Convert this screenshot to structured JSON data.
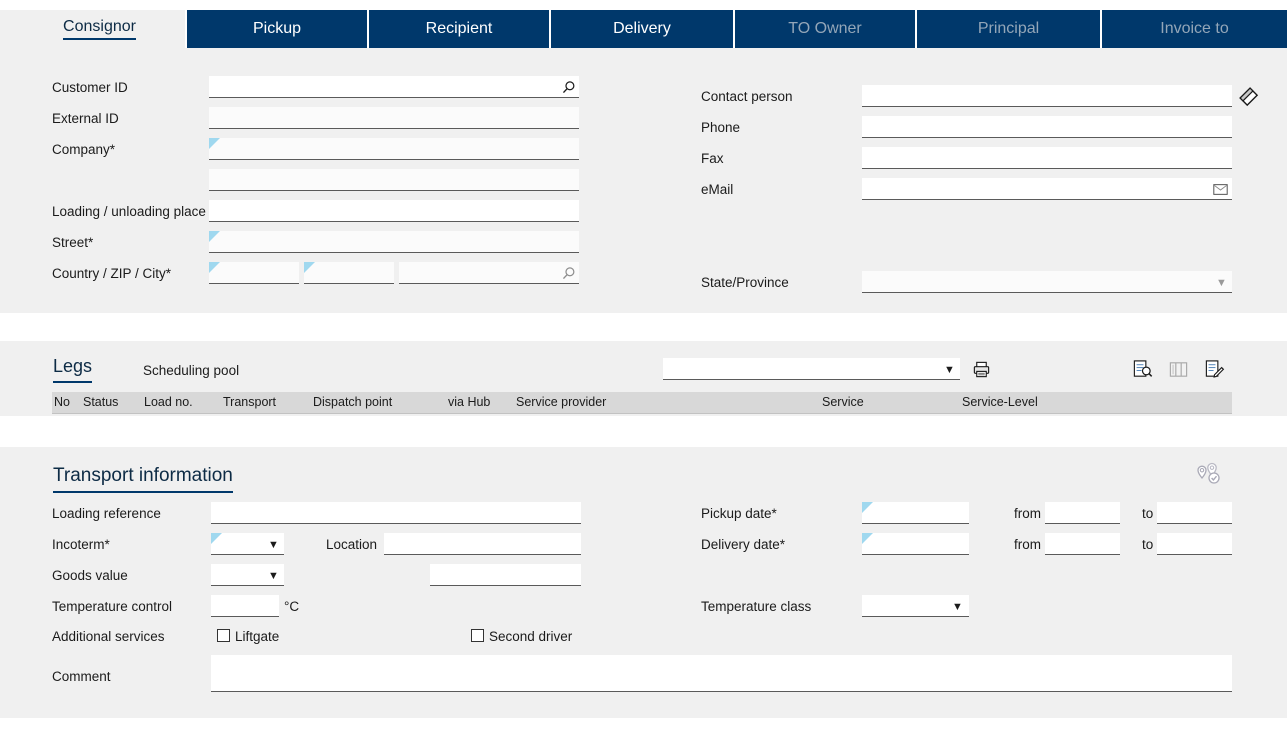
{
  "tabs": [
    {
      "label": "Consignor",
      "state": "active"
    },
    {
      "label": "Pickup",
      "state": "normal"
    },
    {
      "label": "Recipient",
      "state": "normal"
    },
    {
      "label": "Delivery",
      "state": "normal"
    },
    {
      "label": "TO Owner",
      "state": "disabled"
    },
    {
      "label": "Principal",
      "state": "disabled"
    },
    {
      "label": "Invoice to",
      "state": "disabled"
    }
  ],
  "address": {
    "left": {
      "customer_id_label": "Customer ID",
      "customer_id_value": "",
      "external_id_label": "External ID",
      "external_id_value": "",
      "company_label": "Company*",
      "company_value": "",
      "company2_value": "",
      "loading_place_label": "Loading / unloading place",
      "loading_place_value": "",
      "street_label": "Street*",
      "street_value": "",
      "country_link_label": "Country",
      "country_rest_label": " / ZIP / City*",
      "country_value": "",
      "zip_value": "",
      "city_value": ""
    },
    "right": {
      "contact_label": "Contact person",
      "contact_value": "",
      "phone_label": "Phone",
      "phone_value": "",
      "fax_label": "Fax",
      "fax_value": "",
      "email_label": "eMail",
      "email_value": "",
      "state_label": "State/Province",
      "state_value": ""
    }
  },
  "legs": {
    "title": "Legs",
    "scheduling_pool_label": "Scheduling pool",
    "pool_value": "",
    "columns": [
      "No",
      "Status",
      "Load no.",
      "Transport",
      "Dispatch point",
      "via Hub",
      "Service provider",
      "Service",
      "Service-Level"
    ]
  },
  "transport": {
    "title": "Transport information",
    "loading_reference_label": "Loading reference",
    "loading_reference_value": "",
    "incoterm_label": "Incoterm*",
    "incoterm_value": "",
    "location_label": "Location",
    "location_value": "",
    "goods_value_label": "Goods value",
    "goods_value_select": "",
    "goods_value_amount": "",
    "temperature_control_label": "Temperature control",
    "temperature_control_value": "",
    "temperature_unit": "°C",
    "additional_services_label": "Additional services",
    "liftgate_label": "Liftgate",
    "liftgate_checked": false,
    "second_driver_label": "Second driver",
    "second_driver_checked": false,
    "comment_label": "Comment",
    "comment_value": "",
    "pickup_date_label": "Pickup date*",
    "pickup_date_value": "",
    "pickup_from_label": "from",
    "pickup_from_value": "",
    "pickup_to_label": "to",
    "pickup_to_value": "",
    "delivery_date_label": "Delivery date*",
    "delivery_date_value": "",
    "delivery_from_label": "from",
    "delivery_from_value": "",
    "delivery_to_label": "to",
    "delivery_to_value": "",
    "temperature_class_label": "Temperature class",
    "temperature_class_value": ""
  },
  "icons": {
    "search": "search-icon",
    "eraser": "eraser-icon",
    "envelope": "envelope-icon",
    "printer": "printer-icon",
    "doc_search": "document-search-icon",
    "columns": "columns-icon",
    "doc_edit": "document-edit-icon",
    "route_pins": "route-pins-icon"
  },
  "colors": {
    "tab_active_bg": "#f0f0f0",
    "tab_bg": "#00386b",
    "tab_disabled_text": "#93a6b8",
    "panel_bg": "#f0f0f0",
    "accent": "#00386b",
    "required_marker": "#9fd8ef",
    "table_header_bg": "#d8d8d8"
  }
}
